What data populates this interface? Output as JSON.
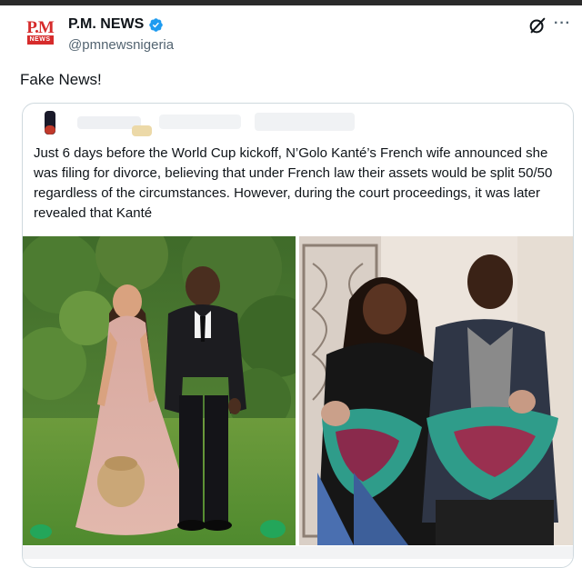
{
  "header": {
    "display_name": "P.M. NEWS",
    "handle": "@pmnewsnigeria",
    "avatar": {
      "top": "P.M",
      "bottom": "NEWS"
    },
    "icons": [
      "verified-badge-icon",
      "grok-icon",
      "more-options-icon"
    ],
    "more_label": "···"
  },
  "tweet": {
    "text": "Fake News!"
  },
  "quoted_post": {
    "text": "Just 6 days before the World Cup kickoff, N’Golo Kanté’s French wife announced she was filing for divorce, believing that under French law their assets would be split 50/50 regardless of the circumstances. However, during the court proceedings, it was later revealed that Kanté",
    "author_blurred": true,
    "photos": [
      {
        "name": "couple-photo",
        "description": "woman in pink gown and man in black suit in a garden"
      },
      {
        "name": "family-photo",
        "description": "couple holding two babies"
      }
    ]
  },
  "colors": {
    "accent_blue": "#1d9bf0",
    "text_primary": "#0f1419",
    "text_secondary": "#536471",
    "border": "#cfd9de",
    "logo_red": "#d62b2b"
  }
}
